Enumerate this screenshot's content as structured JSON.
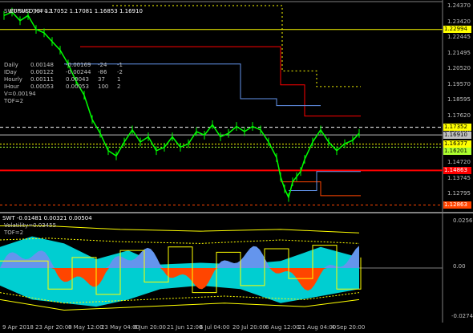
{
  "chart_header": {
    "symbol_line": "EURUSD,H4 1.17052 1.17081 1.16853 1.16910",
    "indicator_tag": "SWT SWT TOF=2"
  },
  "stats_table": {
    "rows": [
      {
        "name": "Daily",
        "a": "0.00148",
        "b": "-0.00169",
        "c": "-24",
        "d": "-1"
      },
      {
        "name": "IDay",
        "a": "0.00122",
        "b": "-0.00244",
        "c": "-86",
        "d": "-2"
      },
      {
        "name": "Hourly",
        "a": "0.00111",
        "b": "0.00043",
        "c": "37",
        "d": "1"
      },
      {
        "name": "IHour",
        "a": "0.00053",
        "b": "0.00053",
        "c": "100",
        "d": "2"
      }
    ],
    "vline": "V=0.00194",
    "tof": "TOF=2"
  },
  "price_axis": {
    "ticks": [
      "1.24370",
      "1.23420",
      "1.22445",
      "1.21495",
      "1.20520",
      "1.19570",
      "1.18595",
      "1.17620",
      "1.16670",
      "1.15695",
      "1.14720",
      "1.13745",
      "1.12795"
    ],
    "tags": [
      {
        "value": "1.22994",
        "bg": "#ffff00",
        "fg": "#000000"
      },
      {
        "value": "1.17352",
        "bg": "#ffff00",
        "fg": "#000000"
      },
      {
        "value": "1.16910",
        "bg": "#c0c0c0",
        "fg": "#000000"
      },
      {
        "value": "1.16377",
        "bg": "#ffff00",
        "fg": "#000000"
      },
      {
        "value": "1.16201",
        "bg": "#adff2f",
        "fg": "#000000"
      },
      {
        "value": "1.14863",
        "bg": "#ff0000",
        "fg": "#ffffff"
      },
      {
        "value": "1.12863",
        "bg": "#ff4500",
        "fg": "#ffffff"
      }
    ]
  },
  "indicator": {
    "header": "SWT -0.01481 0.00321 0.00504",
    "volatility": "Volatility=0.03455",
    "tof": "TOF=2",
    "ticks": [
      "0.02561",
      "0.00",
      "-0.02742"
    ]
  },
  "time_axis": {
    "labels": [
      "9 Apr 2018",
      "23 Apr 20:00",
      "8 May 12:00",
      "23 May 04:00",
      "6 Jun 20:00",
      "21 Jun 12:00",
      "6 Jul 04:00",
      "20 Jul 20:00",
      "6 Aug 12:00",
      "21 Aug 04:00",
      "4 Sep 20:00"
    ]
  },
  "colors": {
    "candle": "#00ff00",
    "ma_line": "#ffff00",
    "support_line": "#ff0000",
    "hist_up": "#ff4500",
    "hist_down": "#6495ed",
    "band_fill": "#00ced1"
  }
}
